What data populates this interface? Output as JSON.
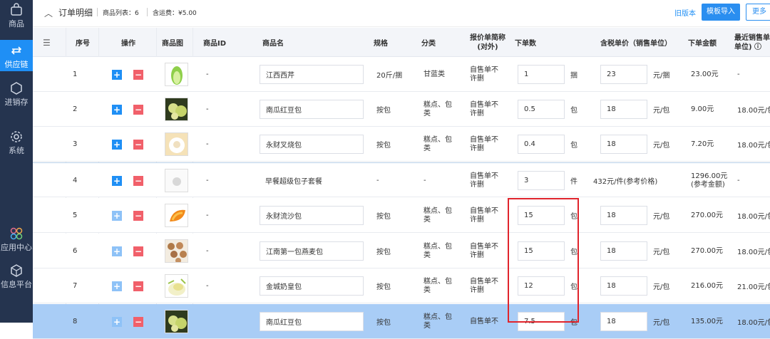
{
  "sidebar": {
    "items": [
      {
        "label": "商品",
        "icon": "shopping-bag-icon"
      },
      {
        "label": "供应链",
        "icon": "exchange-icon"
      },
      {
        "label": "进销存",
        "icon": "cube-icon"
      },
      {
        "label": "系统",
        "icon": "gear-icon"
      },
      {
        "label": "应用中心",
        "icon": "app-center-icon"
      },
      {
        "label": "信息平台",
        "icon": "info-platform-icon"
      }
    ]
  },
  "header": {
    "title": "订单明细",
    "product_count": "商品列表：6",
    "shipping": "含运费：¥5.00",
    "old_version": "旧版本",
    "template_import": "模板导入",
    "more": "更多"
  },
  "table": {
    "columns": {
      "seq": "序号",
      "ops": "操作",
      "image": "商品图",
      "product_id": "商品ID",
      "name": "商品名",
      "spec": "规格",
      "category": "分类",
      "quote": "报价单简称\n(对外)",
      "order_qty": "下单数",
      "tax_price": "含税单价（销售单位）",
      "amount": "下单金额",
      "recent_price": "最近销售单\n单位) ⓘ"
    },
    "rows": [
      {
        "seq": "1",
        "pid": "-",
        "name": "江西西芹",
        "spec": "20斤/捆",
        "category": "甘蓝类",
        "quote": "自售单不\n许删",
        "qty": "1",
        "unit": "捆",
        "price": "23",
        "price_unit": "元/捆",
        "amount": "23.00元",
        "recent": "-",
        "thumb": "celery"
      },
      {
        "seq": "2",
        "pid": "-",
        "name": "南瓜红豆包",
        "spec": "按包",
        "category": "糕点、包\n类",
        "quote": "自售单不\n许删",
        "qty": "0.5",
        "unit": "包",
        "price": "18",
        "price_unit": "元/包",
        "amount": "9.00元",
        "recent": "18.00元/包",
        "thumb": "pumpkin"
      },
      {
        "seq": "3",
        "pid": "-",
        "name": "永财叉烧包",
        "spec": "按包",
        "category": "糕点、包\n类",
        "quote": "自售单不\n许删",
        "qty": "0.4",
        "unit": "包",
        "price": "18",
        "price_unit": "元/包",
        "amount": "7.20元",
        "recent": "18.00元/包",
        "thumb": "bun"
      },
      {
        "seq": "4",
        "pid": "-",
        "name": "早餐超级包子套餐",
        "spec": "-",
        "category": "-",
        "quote": "自售单不\n许删",
        "qty": "3",
        "unit": "件",
        "price_ref": "432元/件(参考价格)",
        "amount": "1296.00元\n(参考金额)",
        "recent": "-",
        "thumb": "combo"
      },
      {
        "seq": "5",
        "pid": "-",
        "name": "永财流沙包",
        "spec": "按包",
        "category": "糕点、包\n类",
        "quote": "自售单不\n许删",
        "qty": "15",
        "unit": "包",
        "price": "18",
        "price_unit": "元/包",
        "amount": "270.00元",
        "recent": "18.00元/包",
        "thumb": "custard"
      },
      {
        "seq": "6",
        "pid": "-",
        "name": "江南第一包燕麦包",
        "spec": "按包",
        "category": "糕点、包\n类",
        "quote": "自售单不\n许删",
        "qty": "15",
        "unit": "包",
        "price": "18",
        "price_unit": "元/包",
        "amount": "270.00元",
        "recent": "18.00元/包",
        "thumb": "oat"
      },
      {
        "seq": "7",
        "pid": "-",
        "name": "金城奶皇包",
        "spec": "按包",
        "category": "糕点、包\n类",
        "quote": "自售单不\n许删",
        "qty": "12",
        "unit": "包",
        "price": "18",
        "price_unit": "元/包",
        "amount": "216.00元",
        "recent": "21.00元/包",
        "thumb": "milk"
      },
      {
        "seq": "8",
        "pid": "",
        "name": "南瓜红豆包",
        "spec": "按包",
        "category": "糕点、包\n类",
        "quote": "自售单不",
        "qty": "7.5",
        "unit": "包",
        "price": "18",
        "price_unit": "元/包",
        "amount": "135.00元",
        "recent": "18.00元/包",
        "thumb": "pumpkin"
      }
    ]
  },
  "colors": {
    "sidebar": "#25344f",
    "accent": "#1f8ff5",
    "danger": "#f1606a",
    "highlight_row": "#a9cdf6",
    "red_box": "#e0242c"
  }
}
